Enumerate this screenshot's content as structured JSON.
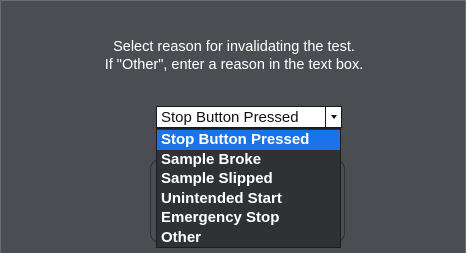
{
  "dialog": {
    "prompt_line1": "Select reason for invalidating the test.",
    "prompt_line2": "If \"Other\", enter a reason in the text box."
  },
  "reason_select": {
    "selected_value": "Stop Button Pressed",
    "options": [
      "Stop Button Pressed",
      "Sample Broke",
      "Sample Slipped",
      "Unintended Start",
      "Emergency Stop",
      "Other"
    ],
    "highlighted_index": 0
  },
  "colors": {
    "dialog_background": "#4a4d52",
    "dropdown_background": "#2f3135",
    "highlight": "#1a73e8",
    "text": "#ffffff"
  },
  "icons": {
    "dropdown_arrow": "chevron-down-icon"
  }
}
